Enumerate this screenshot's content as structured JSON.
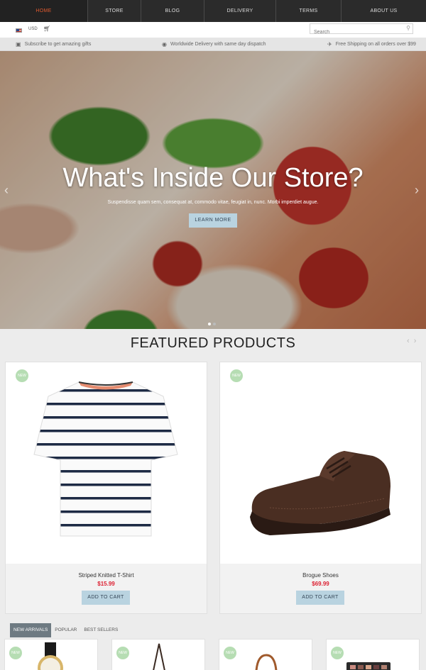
{
  "nav": {
    "items": [
      {
        "label": "HOME",
        "active": true
      },
      {
        "label": "STORE",
        "active": false
      },
      {
        "label": "BLOG",
        "active": false
      },
      {
        "label": "DELIVERY",
        "active": false
      },
      {
        "label": "TERMS",
        "active": false
      },
      {
        "label": "ABOUT US",
        "active": false
      }
    ]
  },
  "utility": {
    "currency": "USD",
    "search_placeholder": "Search"
  },
  "infobar": {
    "subscribe": "Subscribe to get amazing gifts",
    "delivery": "Worldwide Delivery with same day dispatch",
    "shipping": "Free Shipping on all orders over $99"
  },
  "hero": {
    "title": "What's Inside Our Store?",
    "subtitle": "Suspendisse quam sem, consequat at, commodo vitae, feugiat in, nunc. Morbi imperdiet augue.",
    "button": "LEARN MORE"
  },
  "featured": {
    "title": "FEATURED PRODUCTS",
    "products": [
      {
        "badge": "NEW",
        "name": "Striped Knitted T-Shirt",
        "price": "$15.99",
        "button": "ADD TO CART"
      },
      {
        "badge": "NEW",
        "name": "Brogue Shoes",
        "price": "$69.99",
        "button": "ADD TO CART"
      }
    ]
  },
  "tabs": {
    "items": [
      {
        "label": "NEW ARRIVALS",
        "active": true
      },
      {
        "label": "POPULAR",
        "active": false
      },
      {
        "label": "BEST SELLERS",
        "active": false
      }
    ],
    "badge": "NEW"
  },
  "colors": {
    "nav_bg": "#2b2b2b",
    "nav_active_text": "#e05a2f",
    "button_bg": "#b9d3e0",
    "price": "#dd2233",
    "badge": "#b6ddb3"
  }
}
